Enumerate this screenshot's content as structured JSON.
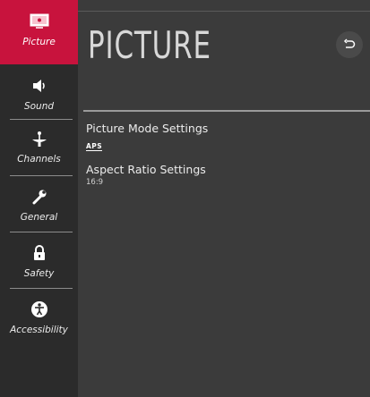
{
  "sidebar": {
    "items": [
      {
        "label": "Picture",
        "icon": "picture-icon",
        "active": true
      },
      {
        "label": "Sound",
        "icon": "speaker-icon",
        "active": false
      },
      {
        "label": "Channels",
        "icon": "antenna-icon",
        "active": false
      },
      {
        "label": "General",
        "icon": "wrench-icon",
        "active": false
      },
      {
        "label": "Safety",
        "icon": "lock-icon",
        "active": false
      },
      {
        "label": "Accessibility",
        "icon": "accessibility-icon",
        "active": false
      }
    ]
  },
  "main": {
    "title": "PICTURE",
    "back_icon": "back-arrow-icon",
    "rows": [
      {
        "title": "Picture Mode Settings",
        "value": "APS"
      },
      {
        "title": "Aspect Ratio Settings",
        "value": "16:9"
      }
    ]
  },
  "colors": {
    "accent": "#c8133d",
    "sidebar_bg": "#2b2b2b",
    "main_bg": "#3b3b3b"
  }
}
